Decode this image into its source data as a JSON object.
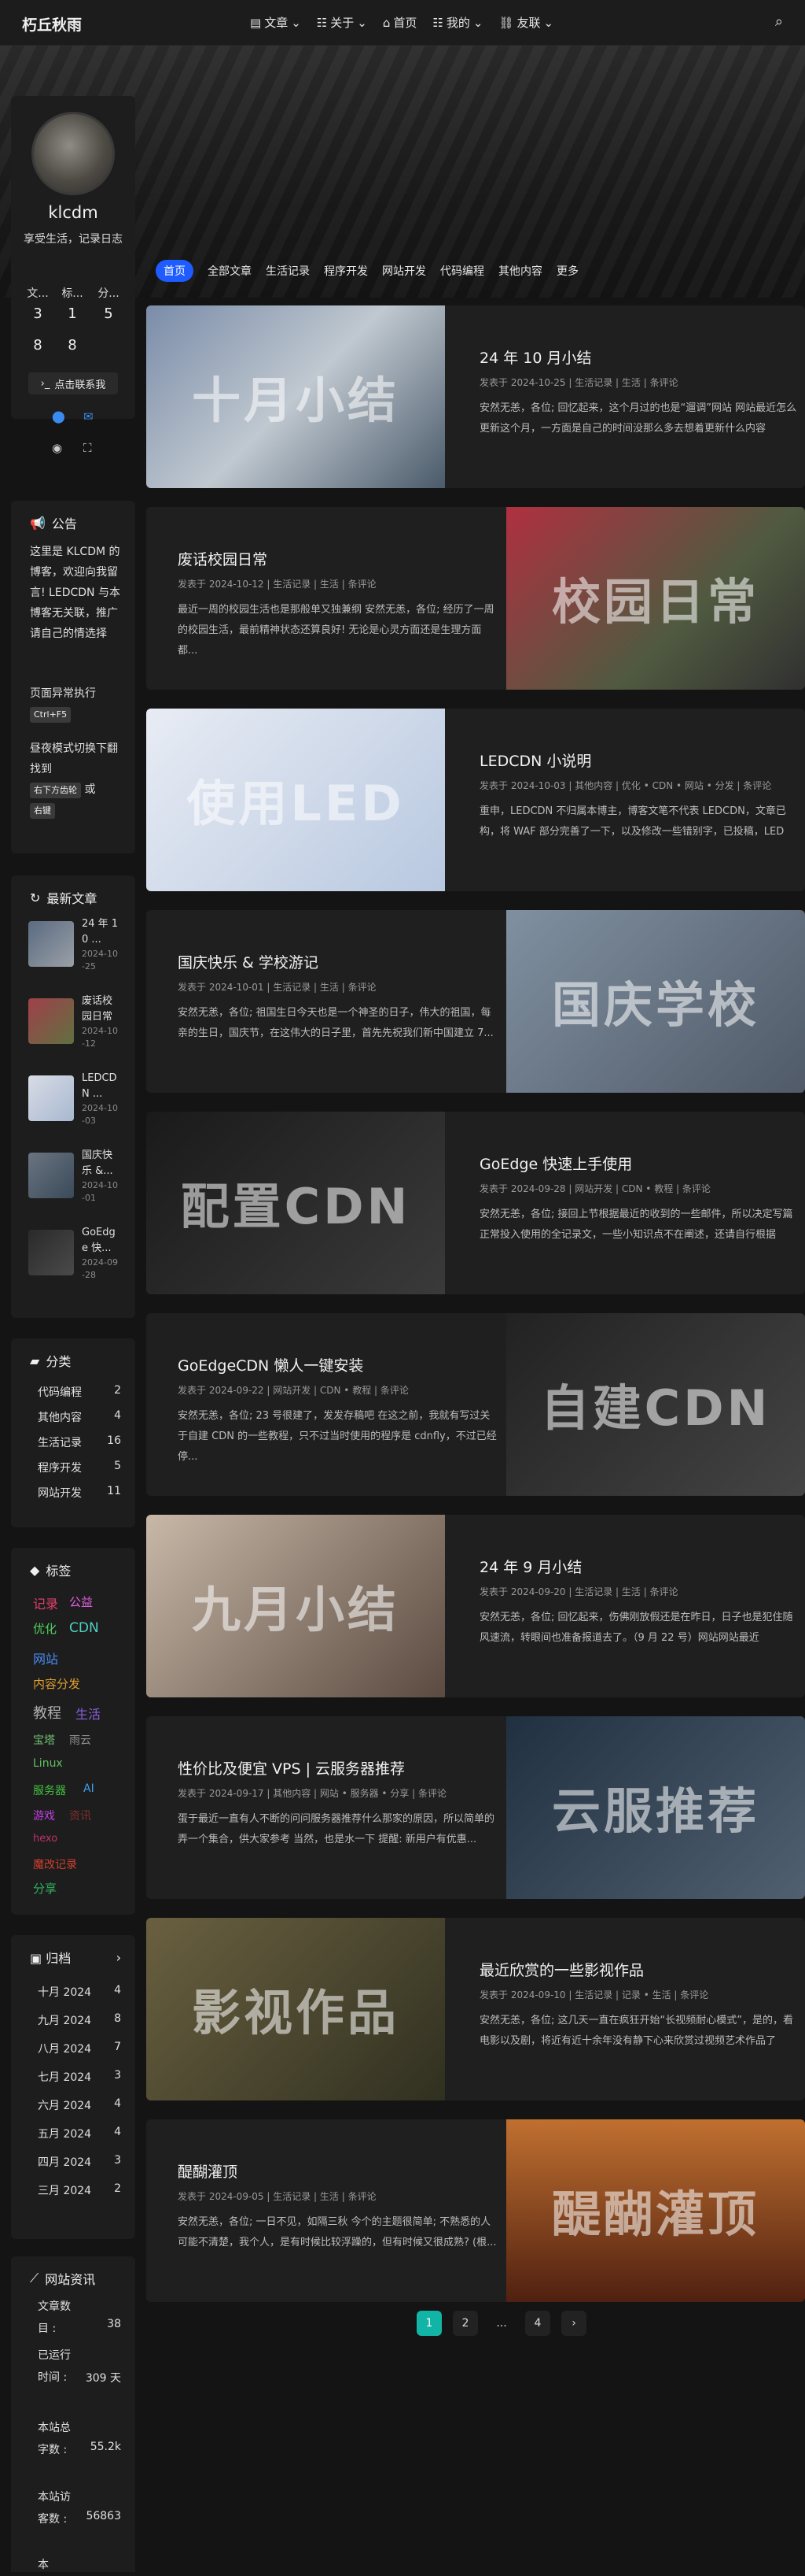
{
  "nav": {
    "brand": "朽丘秋雨",
    "items": [
      "文章",
      "关于",
      "首页",
      "我的",
      "友联"
    ]
  },
  "profile": {
    "name": "klcdm",
    "desc": "享受生活，记录日志",
    "stats": [
      {
        "label": "文...",
        "value": "3"
      },
      {
        "label": "标...",
        "value": "1"
      },
      {
        "label": "分...",
        "value": "5"
      }
    ],
    "stats2": [
      "8",
      "8"
    ],
    "contact": "点击联系我"
  },
  "notice": {
    "title": "公告",
    "text": "这里是 KLCDM 的博客，欢迎向我留言! LEDCDN 与本博客无关联，推广请自己的情选择",
    "p2": "页面异常执行",
    "k1": "Ctrl+F5",
    "p3": "昼夜模式切换下翻找到",
    "k2": "右下方齿轮",
    "or": "或",
    "k3": "右键"
  },
  "recent": {
    "title": "最新文章",
    "items": [
      {
        "t": "24 年 10 ...",
        "d": "2024-10-25"
      },
      {
        "t": "废话校园日常",
        "d": "2024-10-12"
      },
      {
        "t": "LEDCDN ...",
        "d": "2024-10-03"
      },
      {
        "t": "国庆快乐 &...",
        "d": "2024-10-01"
      },
      {
        "t": "GoEdge 快...",
        "d": "2024-09-28"
      }
    ]
  },
  "cats": {
    "title": "分类",
    "items": [
      {
        "n": "代码编程",
        "c": "2"
      },
      {
        "n": "其他内容",
        "c": "4"
      },
      {
        "n": "生活记录",
        "c": "16"
      },
      {
        "n": "程序开发",
        "c": "5"
      },
      {
        "n": "网站开发",
        "c": "11"
      }
    ]
  },
  "tags": {
    "title": "标签",
    "items": [
      {
        "t": "记录",
        "c": "#e0406a"
      },
      {
        "t": "公益",
        "c": "#e060e0"
      },
      {
        "t": "优化",
        "c": "#50d060"
      },
      {
        "t": "CDN",
        "c": "#50d0c0"
      },
      {
        "t": "网站",
        "c": "#4a8af0"
      },
      {
        "t": "内容分发",
        "c": "#e0a030"
      },
      {
        "t": "教程",
        "c": "#b0b0b0"
      },
      {
        "t": "生活",
        "c": "#8a60e0"
      },
      {
        "t": "宝塔",
        "c": "#70c070"
      },
      {
        "t": "雨云",
        "c": "#909090"
      },
      {
        "t": "Linux",
        "c": "#60c060"
      },
      {
        "t": "服务器",
        "c": "#40c040"
      },
      {
        "t": "AI",
        "c": "#40a0f0"
      },
      {
        "t": "游戏",
        "c": "#c040e0"
      },
      {
        "t": "资讯",
        "c": "#803030"
      },
      {
        "t": "hexo",
        "c": "#c0306a"
      },
      {
        "t": "魔改记录",
        "c": "#d04030"
      },
      {
        "t": "分享",
        "c": "#30b060"
      }
    ]
  },
  "archive": {
    "title": "归档",
    "items": [
      {
        "n": "十月 2024",
        "c": "4"
      },
      {
        "n": "九月 2024",
        "c": "8"
      },
      {
        "n": "八月 2024",
        "c": "7"
      },
      {
        "n": "七月 2024",
        "c": "3"
      },
      {
        "n": "六月 2024",
        "c": "4"
      },
      {
        "n": "五月 2024",
        "c": "4"
      },
      {
        "n": "四月 2024",
        "c": "3"
      },
      {
        "n": "三月 2024",
        "c": "2"
      }
    ]
  },
  "site": {
    "title": "网站资讯",
    "l1": "文章数目 :",
    "v1": "38",
    "l2": "已运行时间 :",
    "v2": "309 天",
    "l3": "本站总字数 :",
    "v3": "55.2k",
    "l4": "本站访客数 :",
    "v4": "56863",
    "l5": "本"
  },
  "tabs": [
    "首页",
    "全部文章",
    "生活记录",
    "程序开发",
    "网站开发",
    "代码编程",
    "其他内容",
    "更多"
  ],
  "posts": [
    {
      "title": "24 年 10 月小结",
      "meta": "发表于 2024-10-25 | 生活记录 | 生活 | 条评论",
      "excerpt": "安然无恙，各位; 回忆起来，这个月过的也是“遛调”网站 网站最近怎么更新这个月，一方面是自己的时间没那么多去想着更新什么内容",
      "ovl": "十月小结",
      "side": "left"
    },
    {
      "title": "废话校园日常",
      "meta": "发表于 2024-10-12 | 生活记录 | 生活 | 条评论",
      "excerpt": "最近一周的校园生活也是那般单又独兼纲 安然无恙，各位; 经历了一周的校园生活，最前精神状态还算良好! 无论是心灵方面还是生理方面都...",
      "ovl": "校园日常",
      "side": "right"
    },
    {
      "title": "LEDCDN 小说明",
      "meta": "发表于 2024-10-03 | 其他内容 | 优化 • CDN • 网站 • 分发 | 条评论",
      "excerpt": "重申，LEDCDN 不归属本博主，博客文笔不代表 LEDCDN，文章已构，将 WAF 部分完善了一下，以及修改一些错别字，已投稿，LED",
      "ovl": "使用LED",
      "side": "left"
    },
    {
      "title": "国庆快乐 & 学校游记",
      "meta": "发表于 2024-10-01 | 生活记录 | 生活 | 条评论",
      "excerpt": "安然无恙，各位; 祖国生日今天也是一个神圣的日子，伟大的祖国，每亲的生日，国庆节，在这伟大的日子里，首先先祝我们新中国建立 7...",
      "ovl": "国庆学校",
      "side": "right"
    },
    {
      "title": "GoEdge 快速上手使用",
      "meta": "发表于 2024-09-28 | 网站开发 | CDN • 教程 | 条评论",
      "excerpt": "安然无恙，各位; 接回上节根据最近的收到的一些邮件，所以决定写篇正常投入使用的全记录文，一些小知识点不在阐述，还请自行根据",
      "ovl": "配置CDN",
      "side": "left"
    },
    {
      "title": "GoEdgeCDN 懒人一键安装",
      "meta": "发表于 2024-09-22 | 网站开发 | CDN • 教程 | 条评论",
      "excerpt": "安然无恙，各位; 23 号很建了，发发存稿吧 在这之前，我就有写过关于自建 CDN 的一些教程，只不过当时使用的程序是 cdnfly，不过已经停...",
      "ovl": "自建CDN",
      "side": "right"
    },
    {
      "title": "24 年 9 月小结",
      "meta": "发表于 2024-09-20 | 生活记录 | 生活 | 条评论",
      "excerpt": "安然无恙，各位; 回忆起来，伤佛刚放假还是在昨日，日子也是犯住随风速流，转眼间也准备报道去了。（9 月 22 号）网站网站最近",
      "ovl": "九月小结",
      "side": "left"
    },
    {
      "title": "性价比及便宜 VPS | 云服务器推荐",
      "meta": "发表于 2024-09-17 | 其他内容 | 网站 • 服务器 • 分享 | 条评论",
      "excerpt": "蛋于最近一直有人不断的问问服务器推荐什么那家的原因，所以简单的弄一个集合，供大家参考 当然，也是水一下 提醒: 新用户有优惠...",
      "ovl": "云服推荐",
      "side": "right"
    },
    {
      "title": "最近欣赏的一些影视作品",
      "meta": "发表于 2024-09-10 | 生活记录 | 记录 • 生活 | 条评论",
      "excerpt": "安然无恙，各位; 这几天一直在疯狂开始“长视频耐心模式”，是的，看电影以及剧，将近有近十余年没有静下心来欣赏过视频艺术作品了",
      "ovl": "影视作品",
      "side": "left"
    },
    {
      "title": "醍醐灌顶",
      "meta": "发表于 2024-09-05 | 生活记录 | 生活 | 条评论",
      "excerpt": "安然无恙，各位; 一日不见，如隔三秋 今个的主题很简单; 不熟悉的人可能不清楚，我个人，是有时候比较浮躁的，但有时候又很成熟? (根...",
      "ovl": "醍醐灌顶",
      "side": "right"
    }
  ],
  "pager": [
    "1",
    "2",
    "...",
    "4",
    "›"
  ]
}
